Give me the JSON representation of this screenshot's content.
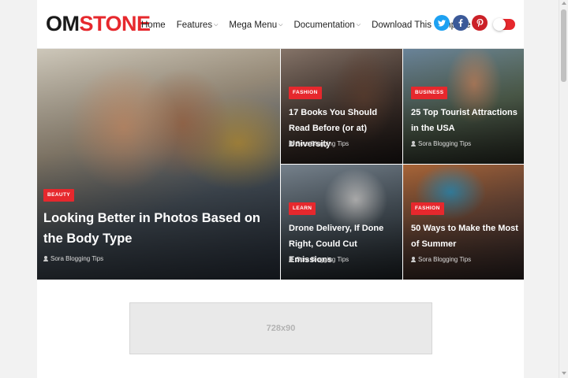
{
  "header": {
    "logo_part1": "OM",
    "logo_part2": "STONE",
    "nav": [
      {
        "label": "Home",
        "dropdown": false
      },
      {
        "label": "Features",
        "dropdown": true
      },
      {
        "label": "Mega Menu",
        "dropdown": true
      },
      {
        "label": "Documentation",
        "dropdown": true
      },
      {
        "label": "Download This Template",
        "dropdown": false
      }
    ],
    "social": [
      {
        "name": "twitter-icon",
        "glyph": "t",
        "color": "#1da1f2"
      },
      {
        "name": "facebook-icon",
        "glyph": "f",
        "color": "#3b5998"
      },
      {
        "name": "pinterest-icon",
        "glyph": "p",
        "color": "#cb2027"
      }
    ],
    "accent_color": "#e6282d"
  },
  "featured": {
    "main": {
      "category": "BEAUTY",
      "title": "Looking Better in Photos Based on the Body Type",
      "author": "Sora Blogging Tips"
    },
    "top_left": {
      "category": "FASHION",
      "title": "17 Books You Should Read Before (or at) University",
      "author": "Sora Blogging Tips"
    },
    "top_right": {
      "category": "BUSINESS",
      "title": "25 Top Tourist Attractions in the USA",
      "author": "Sora Blogging Tips"
    },
    "bottom_left": {
      "category": "LEARN",
      "title": "Drone Delivery, If Done Right, Could Cut Emissions",
      "author": "Sora Blogging Tips"
    },
    "bottom_right": {
      "category": "FASHION",
      "title": "50 Ways to Make the Most of Summer",
      "author": "Sora Blogging Tips"
    }
  },
  "ad": {
    "label": "728x90"
  }
}
